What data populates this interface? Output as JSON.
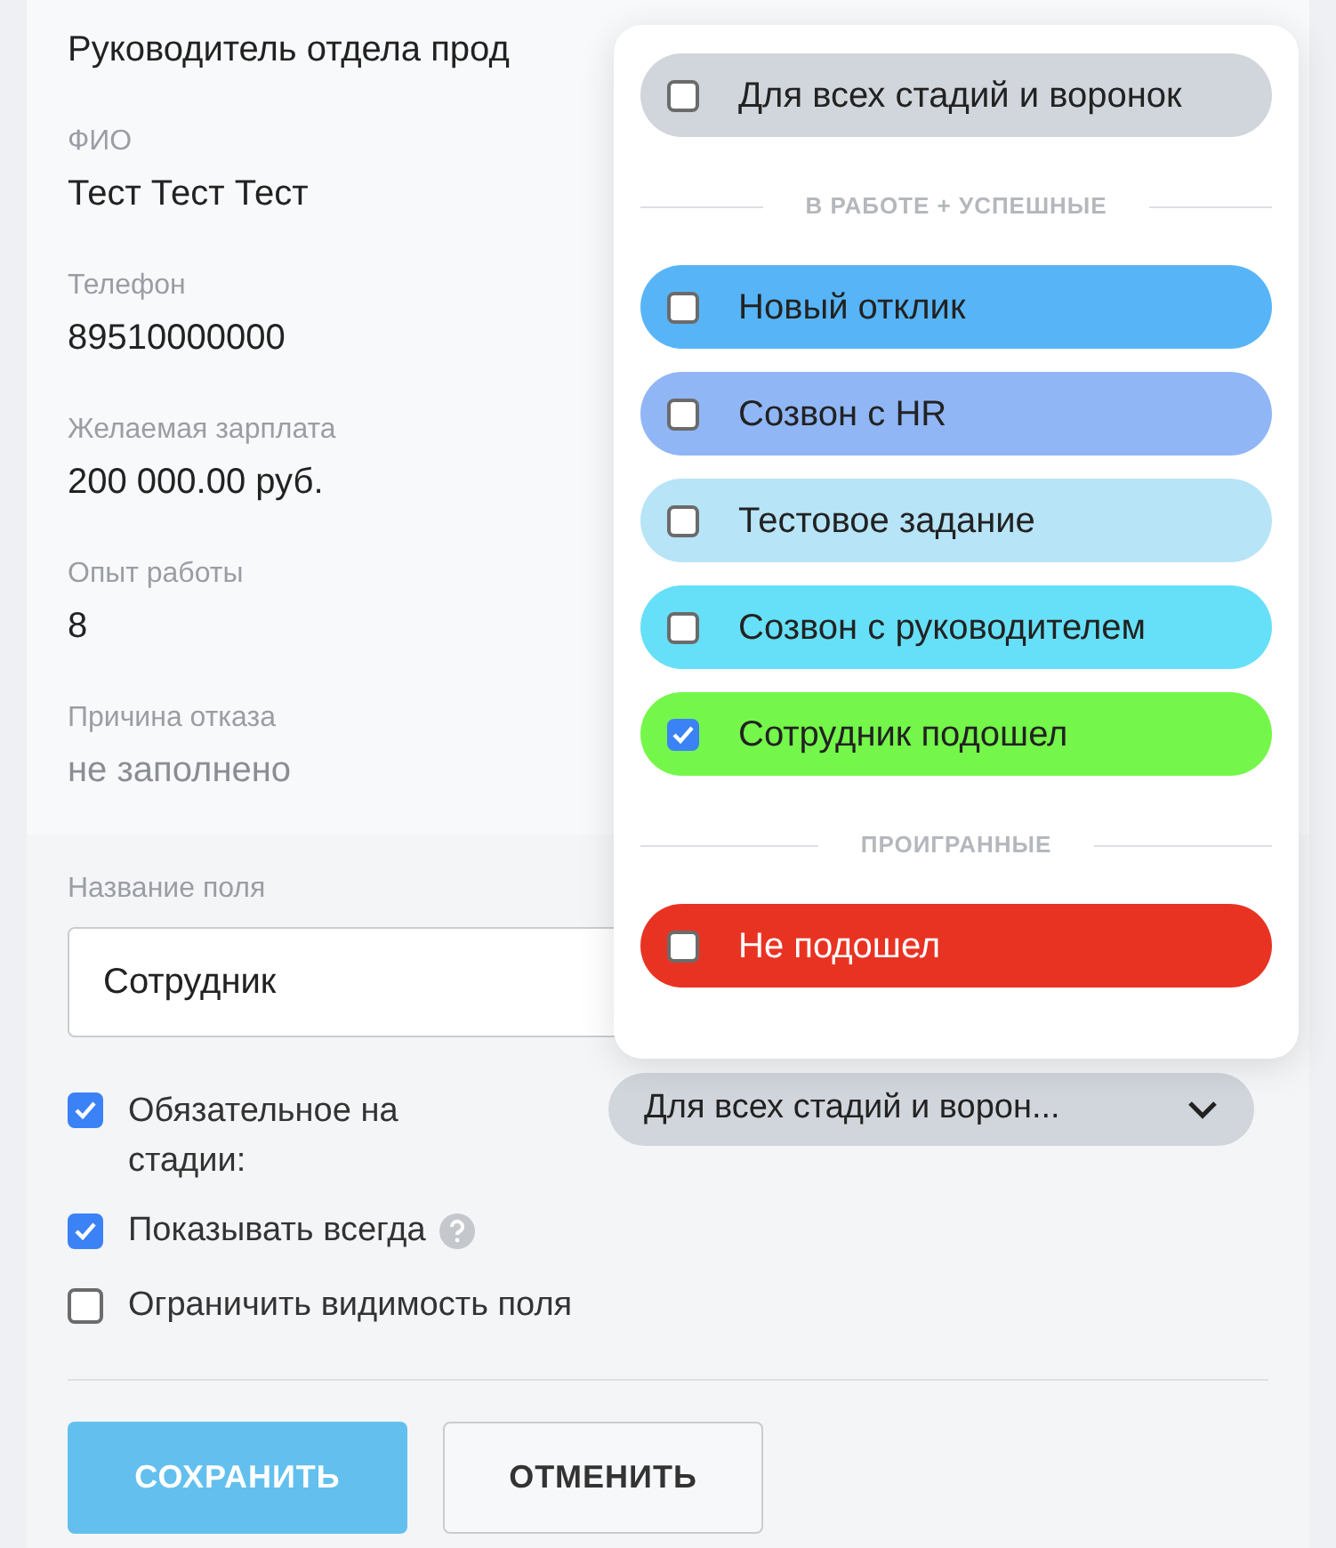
{
  "candidate_fields": [
    {
      "value": "Руководитель отдела прод",
      "empty": false
    },
    {
      "label": "ФИО",
      "value": "Тест Тест Тест",
      "empty": false
    },
    {
      "label": "Телефон",
      "value": "89510000000",
      "empty": false
    },
    {
      "label": "Желаемая зарплата",
      "value": "200 000.00 руб.",
      "empty": false
    },
    {
      "label": "Опыт работы",
      "value": "8",
      "empty": false
    },
    {
      "label": "Причина отказа",
      "value": "не заполнено",
      "empty": true
    }
  ],
  "field_name": {
    "label": "Название поля",
    "value": "Сотрудник"
  },
  "options": [
    {
      "kind": "stage",
      "label": "Обязательное на стадии:",
      "checked": true,
      "select": "Для всех стадий и ворон..."
    },
    {
      "kind": "help",
      "label": "Показывать всегда",
      "checked": true
    },
    {
      "kind": "plain",
      "label": "Ограничить видимость поля",
      "checked": false
    }
  ],
  "buttons": [
    {
      "kind": "primary",
      "label": "СОХРАНИТЬ"
    },
    {
      "kind": "secondary",
      "label": "ОТМЕНИТЬ"
    }
  ],
  "stage_dropdown": {
    "groups": [
      {
        "items": [
          {
            "label": "Для всех стадий и воронок",
            "checked": false,
            "color": "#d1d5dc"
          }
        ]
      },
      {
        "heading": "В РАБОТЕ + УСПЕШНЫЕ",
        "items": [
          {
            "label": "Новый отклик",
            "checked": false,
            "color": "#57b5f7"
          },
          {
            "label": "Созвон с HR",
            "checked": false,
            "color": "#90b6f6"
          },
          {
            "label": "Тестовое задание",
            "checked": false,
            "color": "#b7e4f7"
          },
          {
            "label": "Созвон с руководителем",
            "checked": false,
            "color": "#66e0f8"
          },
          {
            "label": "Сотрудник подошел",
            "checked": true,
            "color": "#74f74a"
          }
        ]
      },
      {
        "heading": "ПРОИГРАННЫЕ",
        "items": [
          {
            "label": "Не подошел",
            "checked": false,
            "color": "#e83323"
          }
        ]
      }
    ]
  }
}
